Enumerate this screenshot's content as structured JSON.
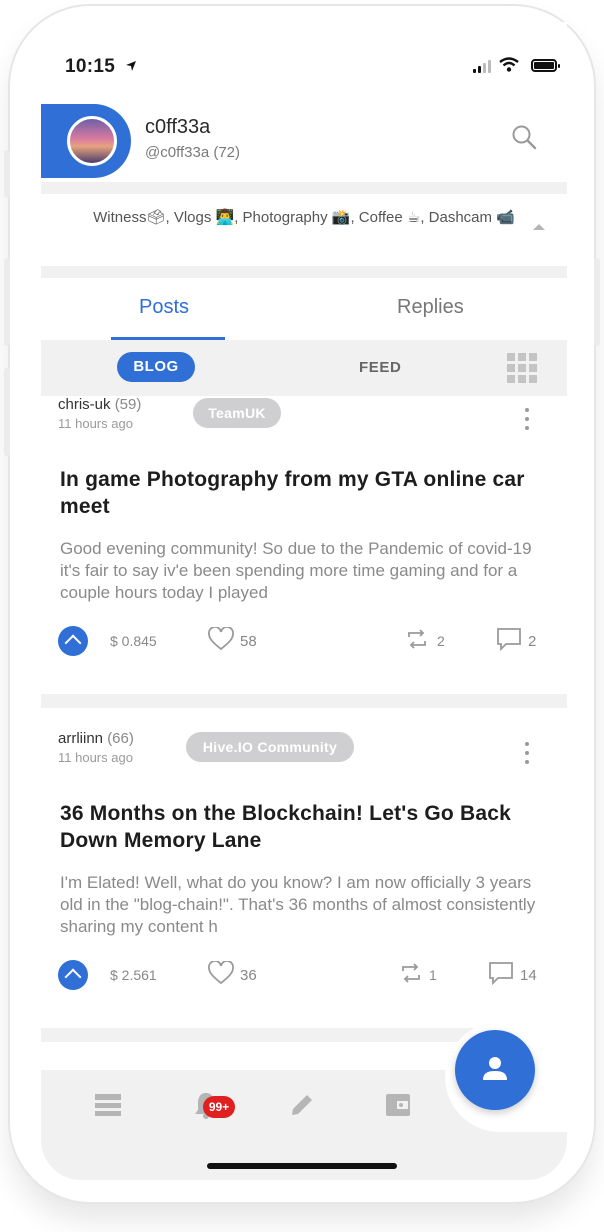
{
  "status_bar": {
    "time": "10:15"
  },
  "profile": {
    "name": "c0ff33a",
    "handle": "@c0ff33a",
    "reputation": "(72)",
    "about": "Witness🗳, Vlogs 👨‍💻, Photography 📸, Coffee ☕, Dashcam 📹"
  },
  "tabs": [
    {
      "label": "Posts",
      "active": true
    },
    {
      "label": "Replies",
      "active": false
    }
  ],
  "filters": {
    "blog_label": "BLOG",
    "feed_label": "FEED"
  },
  "posts": [
    {
      "author": "chris-uk",
      "author_rep": "(59)",
      "time_ago": "11 hours ago",
      "community": "TeamUK",
      "title": "In game Photography from my GTA online car meet",
      "excerpt": "Good evening community! So due to the Pandemic of covid-19 it's fair to say iv'e been spending more time gaming and for a couple hours today I played",
      "payout": "$ 0.845",
      "likes": "58",
      "reblogs": "2",
      "comments": "2"
    },
    {
      "author": "arrliinn",
      "author_rep": "(66)",
      "time_ago": "11 hours ago",
      "community": "Hive.IO Community",
      "title": "36 Months on the Blockchain! Let's Go Back Down Memory Lane",
      "excerpt": "I'm Elated! Well, what do you know? I am now officially 3 years old in the \"blog-chain!\". That's 36 months of almost consistently sharing my content h",
      "payout": "$ 2.561",
      "likes": "36",
      "reblogs": "1",
      "comments": "14"
    }
  ],
  "bottom_nav": {
    "notification_badge": "99+",
    "items": [
      "feed-icon",
      "bell-icon",
      "pencil-icon",
      "wallet-icon",
      "profile-icon"
    ]
  },
  "colors": {
    "accent": "#2f6fd6",
    "badge": "#e02020",
    "chip": "#cfcfd1"
  }
}
